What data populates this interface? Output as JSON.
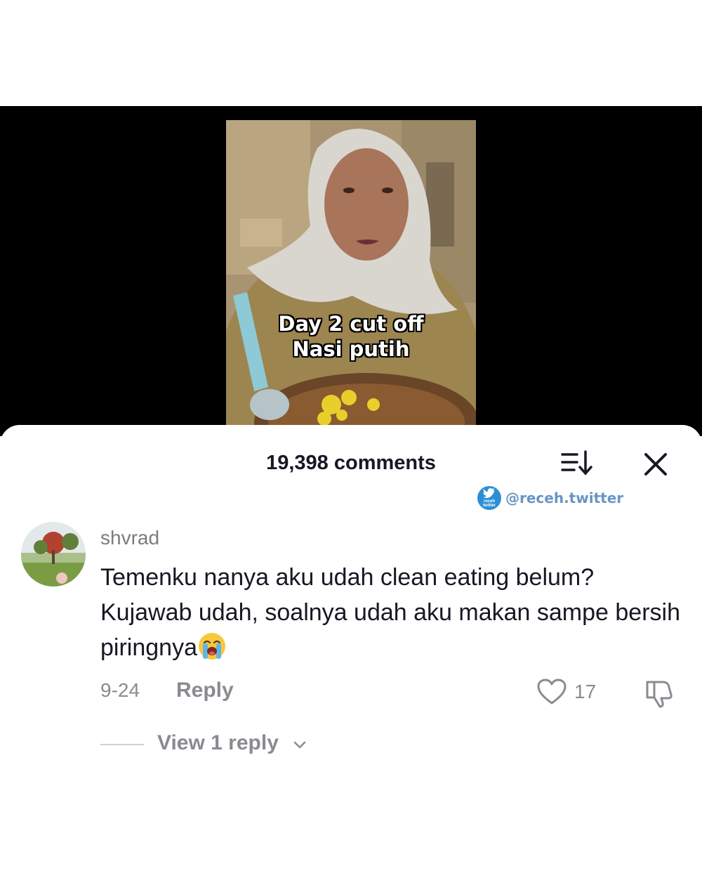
{
  "video": {
    "caption_line1": "Day 2 cut off",
    "caption_line2": "Nasi putih"
  },
  "comments_panel": {
    "count_label": "19,398 comments",
    "sort_icon": "sort-list-icon",
    "close_icon": "close-icon"
  },
  "watermark": {
    "logo_text_1": "receh",
    "logo_text_2": "twitter",
    "handle": "@receh.twitter"
  },
  "comment": {
    "username": "shvrad",
    "text": "Temenku nanya aku udah clean eating belum? Kujawab udah, soalnya udah aku makan sampe bersih piringnya",
    "emoji": "loudly-crying-face-emoji",
    "date": "9-24",
    "reply_label": "Reply",
    "like_count": "17",
    "view_replies_label": "View 1 reply"
  },
  "colors": {
    "text_primary": "#161823",
    "text_secondary": "#8a8b91",
    "watermark_blue": "#6a95c4"
  }
}
